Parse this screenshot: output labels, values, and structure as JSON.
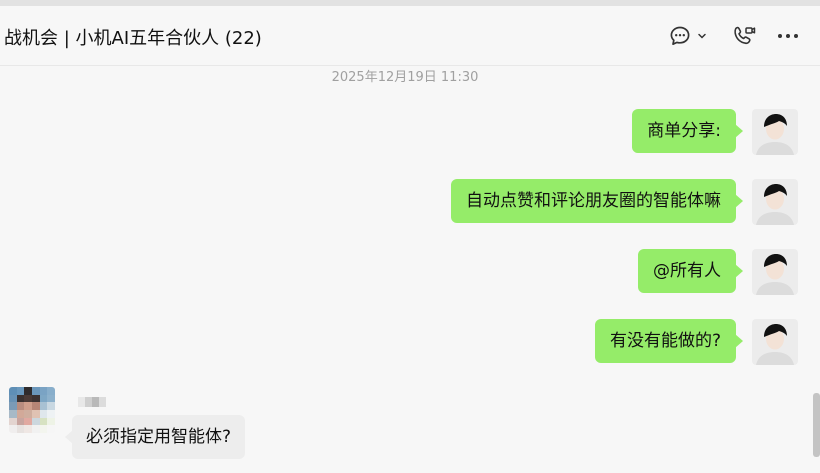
{
  "header": {
    "title": "战机会 | 小机AI五年合伙人 (22)",
    "icons": [
      "chat-bubble-icon",
      "chevron-down-icon",
      "phone-video-icon",
      "more-icon"
    ]
  },
  "chat": {
    "timestamp": "2025年12月19日 11:30",
    "self_messages": [
      {
        "text": "商单分享:"
      },
      {
        "text": "自动点赞和评论朋友圈的智能体嘛"
      },
      {
        "text": "@所有人"
      },
      {
        "text": "有没有能做的?"
      }
    ],
    "other_message": {
      "text": "必须指定用智能体?"
    }
  },
  "colors": {
    "self_bubble": "#95ec69",
    "other_bubble": "#ededed",
    "background": "#f7f7f7"
  }
}
